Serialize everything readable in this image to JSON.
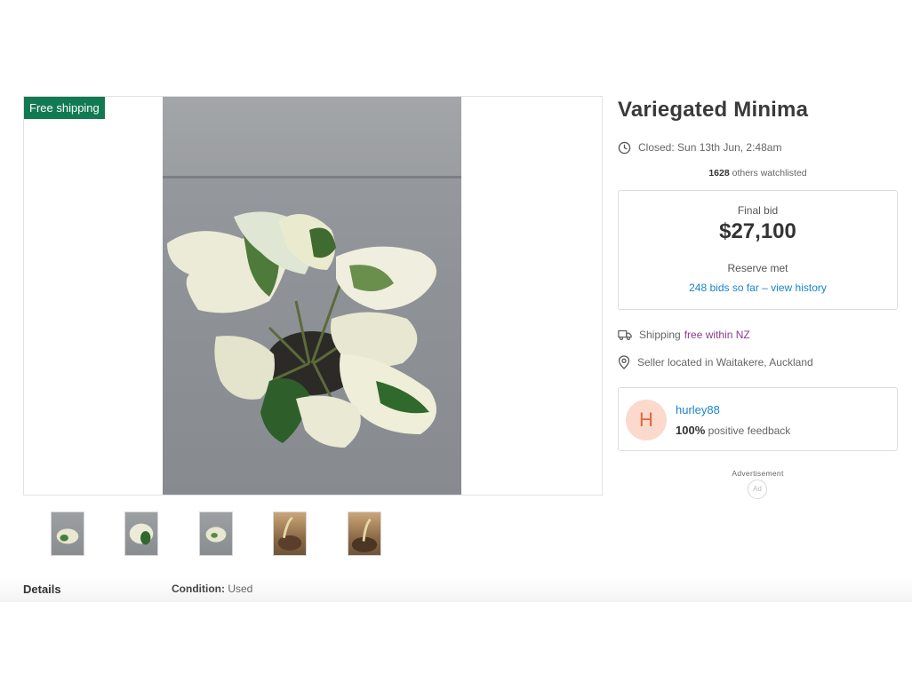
{
  "listing": {
    "title": "Variegated Minima",
    "closed_text": "Closed: Sun 13th Jun, 2:48am",
    "watchlist_count": "1628",
    "watchlist_suffix": " others watchlisted",
    "free_shipping_badge": "Free shipping"
  },
  "bid": {
    "final_label": "Final bid",
    "final_amount": "$27,100",
    "reserve_text": "Reserve met",
    "bids_link": "248 bids so far – view history"
  },
  "shipping": {
    "label": "Shipping",
    "value": "free within NZ"
  },
  "location": {
    "text": "Seller located in Waitakere, Auckland"
  },
  "seller": {
    "initial": "H",
    "name": "hurley88",
    "feedback_percent": "100%",
    "feedback_suffix": " positive feedback"
  },
  "ad": {
    "label": "Advertisement",
    "badge": "Ad"
  },
  "details": {
    "title": "Details",
    "condition_label": "Condition:",
    "condition_value": "Used"
  },
  "colors": {
    "free_shipping_green": "#127a52",
    "link_blue": "#1a84c9",
    "link_purple": "#8a3b8e",
    "avatar_bg": "#fbd9cc",
    "avatar_text": "#e06a3b"
  },
  "icons": {
    "closed": "clock-icon",
    "shipping": "truck-icon",
    "location": "location-pin-icon"
  }
}
